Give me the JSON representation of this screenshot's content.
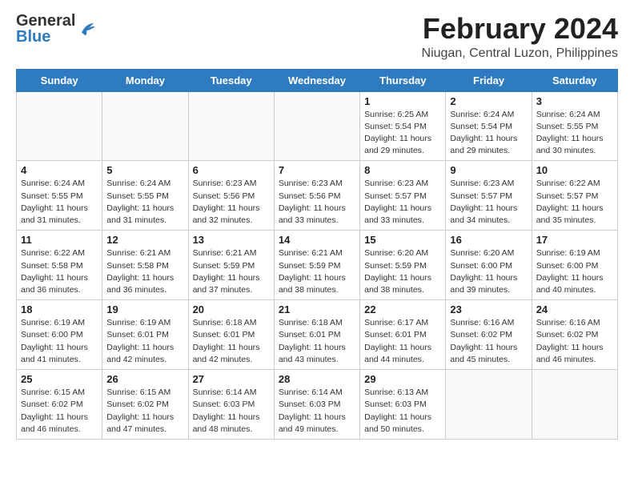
{
  "logo": {
    "general": "General",
    "blue": "Blue"
  },
  "header": {
    "month_year": "February 2024",
    "location": "Niugan, Central Luzon, Philippines"
  },
  "days_of_week": [
    "Sunday",
    "Monday",
    "Tuesday",
    "Wednesday",
    "Thursday",
    "Friday",
    "Saturday"
  ],
  "weeks": [
    [
      {
        "day": "",
        "empty": true
      },
      {
        "day": "",
        "empty": true
      },
      {
        "day": "",
        "empty": true
      },
      {
        "day": "",
        "empty": true
      },
      {
        "day": "1",
        "sunrise": "6:25 AM",
        "sunset": "5:54 PM",
        "daylight": "11 hours and 29 minutes."
      },
      {
        "day": "2",
        "sunrise": "6:24 AM",
        "sunset": "5:54 PM",
        "daylight": "11 hours and 29 minutes."
      },
      {
        "day": "3",
        "sunrise": "6:24 AM",
        "sunset": "5:55 PM",
        "daylight": "11 hours and 30 minutes."
      }
    ],
    [
      {
        "day": "4",
        "sunrise": "6:24 AM",
        "sunset": "5:55 PM",
        "daylight": "11 hours and 31 minutes."
      },
      {
        "day": "5",
        "sunrise": "6:24 AM",
        "sunset": "5:55 PM",
        "daylight": "11 hours and 31 minutes."
      },
      {
        "day": "6",
        "sunrise": "6:23 AM",
        "sunset": "5:56 PM",
        "daylight": "11 hours and 32 minutes."
      },
      {
        "day": "7",
        "sunrise": "6:23 AM",
        "sunset": "5:56 PM",
        "daylight": "11 hours and 33 minutes."
      },
      {
        "day": "8",
        "sunrise": "6:23 AM",
        "sunset": "5:57 PM",
        "daylight": "11 hours and 33 minutes."
      },
      {
        "day": "9",
        "sunrise": "6:23 AM",
        "sunset": "5:57 PM",
        "daylight": "11 hours and 34 minutes."
      },
      {
        "day": "10",
        "sunrise": "6:22 AM",
        "sunset": "5:57 PM",
        "daylight": "11 hours and 35 minutes."
      }
    ],
    [
      {
        "day": "11",
        "sunrise": "6:22 AM",
        "sunset": "5:58 PM",
        "daylight": "11 hours and 36 minutes."
      },
      {
        "day": "12",
        "sunrise": "6:21 AM",
        "sunset": "5:58 PM",
        "daylight": "11 hours and 36 minutes."
      },
      {
        "day": "13",
        "sunrise": "6:21 AM",
        "sunset": "5:59 PM",
        "daylight": "11 hours and 37 minutes."
      },
      {
        "day": "14",
        "sunrise": "6:21 AM",
        "sunset": "5:59 PM",
        "daylight": "11 hours and 38 minutes."
      },
      {
        "day": "15",
        "sunrise": "6:20 AM",
        "sunset": "5:59 PM",
        "daylight": "11 hours and 38 minutes."
      },
      {
        "day": "16",
        "sunrise": "6:20 AM",
        "sunset": "6:00 PM",
        "daylight": "11 hours and 39 minutes."
      },
      {
        "day": "17",
        "sunrise": "6:19 AM",
        "sunset": "6:00 PM",
        "daylight": "11 hours and 40 minutes."
      }
    ],
    [
      {
        "day": "18",
        "sunrise": "6:19 AM",
        "sunset": "6:00 PM",
        "daylight": "11 hours and 41 minutes."
      },
      {
        "day": "19",
        "sunrise": "6:19 AM",
        "sunset": "6:01 PM",
        "daylight": "11 hours and 42 minutes."
      },
      {
        "day": "20",
        "sunrise": "6:18 AM",
        "sunset": "6:01 PM",
        "daylight": "11 hours and 42 minutes."
      },
      {
        "day": "21",
        "sunrise": "6:18 AM",
        "sunset": "6:01 PM",
        "daylight": "11 hours and 43 minutes."
      },
      {
        "day": "22",
        "sunrise": "6:17 AM",
        "sunset": "6:01 PM",
        "daylight": "11 hours and 44 minutes."
      },
      {
        "day": "23",
        "sunrise": "6:16 AM",
        "sunset": "6:02 PM",
        "daylight": "11 hours and 45 minutes."
      },
      {
        "day": "24",
        "sunrise": "6:16 AM",
        "sunset": "6:02 PM",
        "daylight": "11 hours and 46 minutes."
      }
    ],
    [
      {
        "day": "25",
        "sunrise": "6:15 AM",
        "sunset": "6:02 PM",
        "daylight": "11 hours and 46 minutes."
      },
      {
        "day": "26",
        "sunrise": "6:15 AM",
        "sunset": "6:02 PM",
        "daylight": "11 hours and 47 minutes."
      },
      {
        "day": "27",
        "sunrise": "6:14 AM",
        "sunset": "6:03 PM",
        "daylight": "11 hours and 48 minutes."
      },
      {
        "day": "28",
        "sunrise": "6:14 AM",
        "sunset": "6:03 PM",
        "daylight": "11 hours and 49 minutes."
      },
      {
        "day": "29",
        "sunrise": "6:13 AM",
        "sunset": "6:03 PM",
        "daylight": "11 hours and 50 minutes."
      },
      {
        "day": "",
        "empty": true
      },
      {
        "day": "",
        "empty": true
      }
    ]
  ],
  "labels": {
    "sunrise": "Sunrise:",
    "sunset": "Sunset:",
    "daylight": "Daylight:"
  }
}
